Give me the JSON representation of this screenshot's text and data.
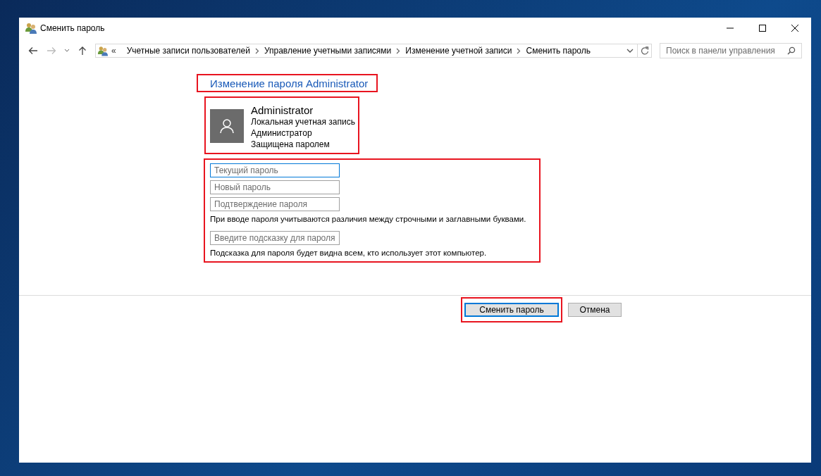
{
  "window": {
    "title": "Сменить пароль"
  },
  "address_bar": {
    "prefix": "«",
    "crumbs": [
      "Учетные записи пользователей",
      "Управление учетными записями",
      "Изменение учетной записи",
      "Сменить пароль"
    ]
  },
  "search": {
    "placeholder": "Поиск в панели управления"
  },
  "heading": {
    "text": "Изменение пароля Administrator",
    "highlighted": true
  },
  "account": {
    "highlighted": true,
    "name": "Administrator",
    "lines": [
      "Локальная учетная запись",
      "Администратор",
      "Защищена паролем"
    ]
  },
  "form": {
    "highlighted": true,
    "items": [
      {
        "kind": "field",
        "placeholder": "Текущий пароль",
        "focused": true
      },
      {
        "kind": "field",
        "placeholder": "Новый пароль",
        "focused": false
      },
      {
        "kind": "field",
        "placeholder": "Подтверждение пароля",
        "focused": false
      },
      {
        "kind": "note",
        "text": "При вводе пароля учитываются различия между строчными и заглавными буквами."
      },
      {
        "kind": "field",
        "placeholder": "Введите подсказку для пароля",
        "focused": false
      },
      {
        "kind": "note",
        "text": "Подсказка для пароля будет видна всем, кто использует этот компьютер."
      }
    ]
  },
  "buttons": [
    {
      "label": "Сменить пароль",
      "default": true,
      "highlighted": true
    },
    {
      "label": "Отмена",
      "default": false,
      "highlighted": false
    }
  ]
}
